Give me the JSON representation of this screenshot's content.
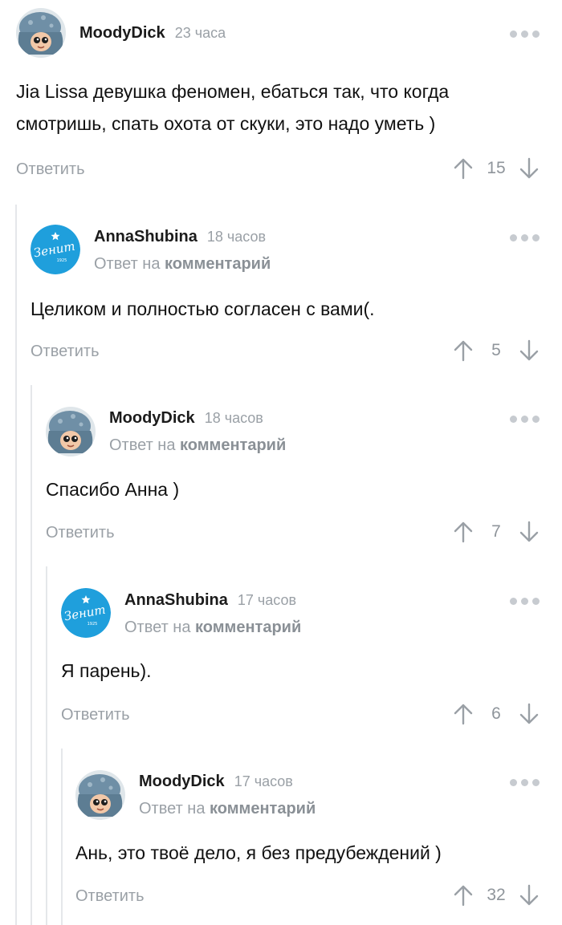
{
  "comments": [
    {
      "author": "MoodyDick",
      "time": "23 часа",
      "avatar": "octopus-avatar",
      "reply_to": null,
      "text": [
        "Jia Lissa девушка феномен, ебаться так, что когда",
        "смотришь, спать охота от скуки, это надо уметь )"
      ],
      "reply_label": "Ответить",
      "score": "15"
    },
    {
      "author": "AnnaShubina",
      "time": "18 часов",
      "avatar": "zenit-avatar",
      "reply_to": {
        "prefix": "Ответ на",
        "link": "комментарий"
      },
      "text": [
        "Целиком и полностью согласен с вами(."
      ],
      "reply_label": "Ответить",
      "score": "5"
    },
    {
      "author": "MoodyDick",
      "time": "18 часов",
      "avatar": "octopus-avatar",
      "reply_to": {
        "prefix": "Ответ на",
        "link": "комментарий"
      },
      "text": [
        "Спасибо Анна )"
      ],
      "reply_label": "Ответить",
      "score": "7"
    },
    {
      "author": "AnnaShubina",
      "time": "17 часов",
      "avatar": "zenit-avatar",
      "reply_to": {
        "prefix": "Ответ на",
        "link": "комментарий"
      },
      "text": [
        "Я парень)."
      ],
      "reply_label": "Ответить",
      "score": "6"
    },
    {
      "author": "MoodyDick",
      "time": "17 часов",
      "avatar": "octopus-avatar",
      "reply_to": {
        "prefix": "Ответ на",
        "link": "комментарий"
      },
      "text": [
        "Ань, это твоё дело, я без предубеждений )"
      ],
      "reply_label": "Ответить",
      "score": "32"
    }
  ],
  "zenit_logo": {
    "word": "Зенит",
    "year": "1925"
  },
  "colors": {
    "meta": "#9aa0a6",
    "thread_line": "#e5e7ea",
    "zenit_blue": "#1f9fdc",
    "octopus": "#6f8fa6"
  }
}
